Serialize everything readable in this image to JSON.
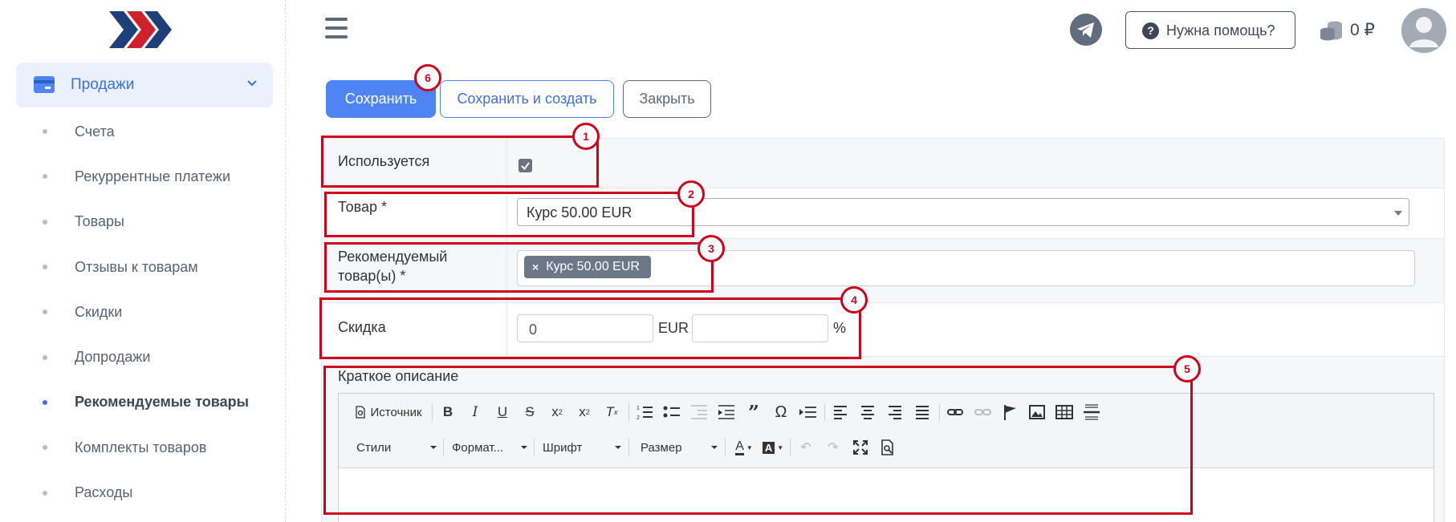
{
  "sidebar": {
    "section": {
      "label": "Продажи",
      "icon": "credit-card-icon"
    },
    "items": [
      {
        "label": "Счета",
        "active": false
      },
      {
        "label": "Рекуррентные платежи",
        "active": false
      },
      {
        "label": "Товары",
        "active": false
      },
      {
        "label": "Отзывы к товарам",
        "active": false
      },
      {
        "label": "Скидки",
        "active": false
      },
      {
        "label": "Допродажи",
        "active": false
      },
      {
        "label": "Рекомендуемые товары",
        "active": true
      },
      {
        "label": "Комплекты товаров",
        "active": false
      },
      {
        "label": "Расходы",
        "active": false
      }
    ]
  },
  "header": {
    "help_label": "Нужна помощь?",
    "balance": "0 ₽"
  },
  "actions": {
    "save": "Сохранить",
    "save_create": "Сохранить и создать",
    "close": "Закрыть"
  },
  "form": {
    "used_label": "Используется",
    "used_checked": true,
    "product_label": "Товар *",
    "product_value": "Курс 50.00 EUR",
    "recommended_label_line1": "Рекомендуемый",
    "recommended_label_line2": "товар(ы) *",
    "recommended_tag": "Курс 50.00 EUR",
    "discount_label": "Скидка",
    "discount_value": "0",
    "discount_currency": "EUR",
    "discount_percent_value": "",
    "discount_percent_sign": "%",
    "short_desc_label": "Краткое описание"
  },
  "editor": {
    "source_label": "Источник",
    "styles_label": "Стили",
    "format_label": "Формат...",
    "font_label": "Шрифт",
    "size_label": "Размер"
  },
  "annotations": [
    "1",
    "2",
    "3",
    "4",
    "5",
    "6"
  ],
  "colors": {
    "accent": "#4e84f4",
    "annotation": "#d0021b",
    "sidebar_active_bg": "#eaf1fd"
  }
}
